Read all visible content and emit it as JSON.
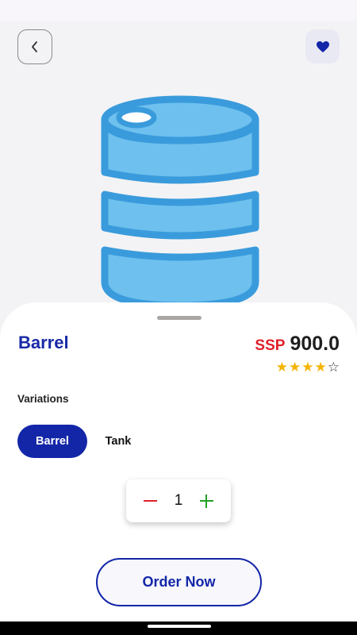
{
  "product": {
    "name": "Barrel",
    "currency": "SSP",
    "price": "900.0",
    "rating": 4,
    "rating_max": 5,
    "image_icon": "barrel-icon"
  },
  "variations": {
    "label": "Variations",
    "options": [
      "Barrel",
      "Tank"
    ],
    "selected": "Barrel"
  },
  "quantity": {
    "value": "1"
  },
  "actions": {
    "order_label": "Order Now"
  },
  "colors": {
    "accent": "#1326a8",
    "currency": "#e0202a",
    "star": "#f4b400",
    "barrel_fill": "#6ec0ee",
    "barrel_stroke": "#3a9bdc",
    "plus": "#22a022"
  }
}
